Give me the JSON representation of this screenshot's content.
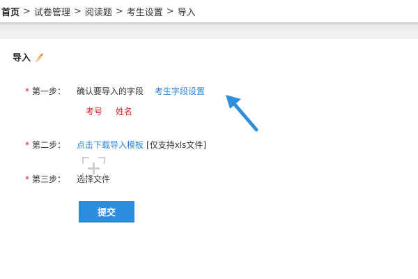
{
  "breadcrumb": {
    "items": [
      "首页",
      "试卷管理",
      "阅读题",
      "考生设置",
      "导入"
    ],
    "separator": ">"
  },
  "section": {
    "title": "导入",
    "icon": "feather-icon"
  },
  "steps": [
    {
      "required_mark": "*",
      "label": "第一步：",
      "text": "确认要导入的字段",
      "link": "考生字段设置",
      "fields": [
        "考号",
        "姓名"
      ]
    },
    {
      "required_mark": "*",
      "label": "第二步：",
      "link": "点击下载导入模板",
      "note": "[仅支持xls文件]"
    },
    {
      "required_mark": "*",
      "label": "第三步：",
      "text": "选择文件"
    }
  ],
  "submit_label": "提交",
  "colors": {
    "link": "#2d84d8",
    "required": "#e02020",
    "button": "#2b8ce0",
    "arrow": "#2f8fdc"
  }
}
